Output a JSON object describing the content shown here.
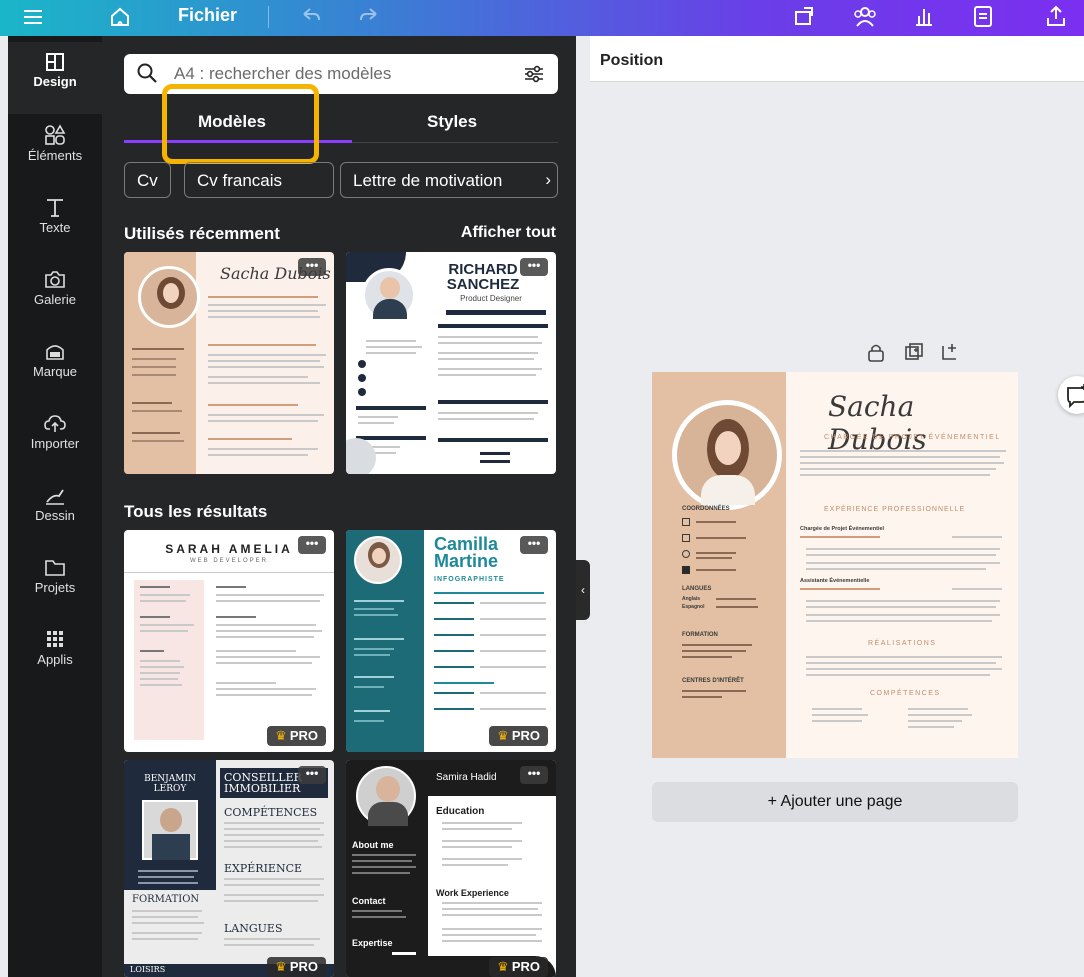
{
  "topbar": {
    "menu_icon": "hamburger-icon",
    "home_icon": "home-icon",
    "file_label": "Fichier",
    "undo_icon": "undo-icon",
    "redo_icon": "redo-icon",
    "right_icons": [
      "resize-icon",
      "collaborate-icon",
      "analytics-icon",
      "notes-icon",
      "share-upload-icon"
    ]
  },
  "sidebar": {
    "items": [
      {
        "label": "Design",
        "icon": "layout-icon"
      },
      {
        "label": "Éléments",
        "icon": "shapes-icon"
      },
      {
        "label": "Texte",
        "icon": "text-icon"
      },
      {
        "label": "Galerie",
        "icon": "camera-icon"
      },
      {
        "label": "Marque",
        "icon": "brand-icon"
      },
      {
        "label": "Importer",
        "icon": "cloud-upload-icon"
      },
      {
        "label": "Dessin",
        "icon": "draw-icon"
      },
      {
        "label": "Projets",
        "icon": "folder-icon"
      },
      {
        "label": "Applis",
        "icon": "apps-grid-icon"
      }
    ]
  },
  "panel": {
    "search": {
      "placeholder": "A4 : rechercher des modèles"
    },
    "tabs": [
      {
        "label": "Modèles"
      },
      {
        "label": "Styles"
      }
    ],
    "chips": [
      {
        "label": "Cv"
      },
      {
        "label": "Cv francais"
      },
      {
        "label": "Lettre de motivation"
      }
    ],
    "recent": {
      "title": "Utilisés récemment",
      "show_all": "Afficher tout",
      "templates": [
        {
          "name": "Sacha Dubois",
          "more": "•••"
        },
        {
          "name": "RICHARD SANCHEZ",
          "subtitle": "Product Designer",
          "more": "•••"
        }
      ]
    },
    "results": {
      "title": "Tous les résultats",
      "templates": [
        {
          "name": "SARAH AMELIA",
          "subtitle": "WEB DEVELOPER",
          "badge": "PRO",
          "more": "•••"
        },
        {
          "name": "Camilla Martine",
          "subtitle": "INFOGRAPHISTE",
          "badge": "PRO",
          "more": "•••"
        },
        {
          "name": "BENJAMIN LEROY",
          "subtitle": "CONSEILLER IMMOBILIER",
          "badge": "PRO",
          "more": "•••"
        },
        {
          "name": "Samira Hadid",
          "subtitle": "Education",
          "badge": "PRO",
          "more": "•••"
        }
      ]
    }
  },
  "canvas": {
    "toolbar_label": "Position",
    "page_tools": [
      "lock-icon",
      "duplicate-page-icon",
      "add-page-icon"
    ],
    "resume": {
      "name": "Sacha Dubois",
      "role": "CHARGÉE DE PROJET ÉVÉNEMENTIEL",
      "coords_title": "COORDONNÉES",
      "langs_title": "LANGUES",
      "formation_title": "FORMATION",
      "interests_title": "CENTRES D'INTÉRÊT",
      "experience_title": "EXPÉRIENCE PROFESSIONNELLE",
      "job1": "Chargée de Projet Événementiel",
      "job2": "Assistante Événementielle",
      "achievements_title": "RÉALISATIONS",
      "skills_title": "COMPÉTENCES",
      "lang1": "Anglais",
      "lang2": "Espagnol"
    },
    "add_page_label": "+ Ajouter une page",
    "comment_icon": "add-comment-icon"
  },
  "colors": {
    "accent": "#8b3dff",
    "highlight": "#f5b400",
    "panel": "#252627",
    "sidebar": "#18191b",
    "resume_tan": "#e3c0a3"
  }
}
